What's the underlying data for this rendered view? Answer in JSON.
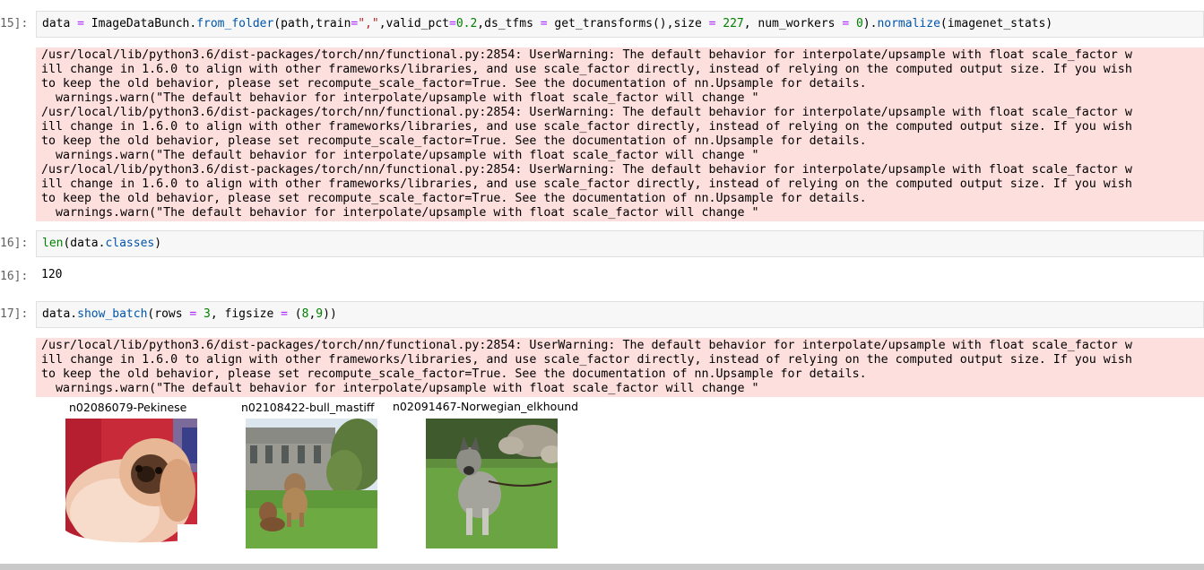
{
  "cells": [
    {
      "prompt": "15]:",
      "code_parts": [
        {
          "t": "data ",
          "c": "plain"
        },
        {
          "t": "=",
          "c": "op"
        },
        {
          "t": " ImageDataBunch.",
          "c": "plain"
        },
        {
          "t": "from_folder",
          "c": "fn"
        },
        {
          "t": "(path,train",
          "c": "plain"
        },
        {
          "t": "=",
          "c": "op"
        },
        {
          "t": "\",\"",
          "c": "str"
        },
        {
          "t": ",valid_pct",
          "c": "plain"
        },
        {
          "t": "=",
          "c": "op"
        },
        {
          "t": "0.2",
          "c": "num"
        },
        {
          "t": ",ds_tfms ",
          "c": "plain"
        },
        {
          "t": "=",
          "c": "op"
        },
        {
          "t": " get_transforms(),size ",
          "c": "plain"
        },
        {
          "t": "=",
          "c": "op"
        },
        {
          "t": " ",
          "c": "plain"
        },
        {
          "t": "227",
          "c": "num"
        },
        {
          "t": ", num_workers ",
          "c": "plain"
        },
        {
          "t": "=",
          "c": "op"
        },
        {
          "t": " ",
          "c": "plain"
        },
        {
          "t": "0",
          "c": "num"
        },
        {
          "t": ").",
          "c": "plain"
        },
        {
          "t": "normalize",
          "c": "fn"
        },
        {
          "t": "(imagenet_stats)",
          "c": "plain"
        }
      ],
      "stderr": [
        "/usr/local/lib/python3.6/dist-packages/torch/nn/functional.py:2854: UserWarning: The default behavior for interpolate/upsample with float scale_factor w",
        "ill change in 1.6.0 to align with other frameworks/libraries, and use scale_factor directly, instead of relying on the computed output size. If you wish",
        "to keep the old behavior, please set recompute_scale_factor=True. See the documentation of nn.Upsample for details.",
        "  warnings.warn(\"The default behavior for interpolate/upsample with float scale_factor will change \"",
        "/usr/local/lib/python3.6/dist-packages/torch/nn/functional.py:2854: UserWarning: The default behavior for interpolate/upsample with float scale_factor w",
        "ill change in 1.6.0 to align with other frameworks/libraries, and use scale_factor directly, instead of relying on the computed output size. If you wish",
        "to keep the old behavior, please set recompute_scale_factor=True. See the documentation of nn.Upsample for details.",
        "  warnings.warn(\"The default behavior for interpolate/upsample with float scale_factor will change \"",
        "/usr/local/lib/python3.6/dist-packages/torch/nn/functional.py:2854: UserWarning: The default behavior for interpolate/upsample with float scale_factor w",
        "ill change in 1.6.0 to align with other frameworks/libraries, and use scale_factor directly, instead of relying on the computed output size. If you wish",
        "to keep the old behavior, please set recompute_scale_factor=True. See the documentation of nn.Upsample for details.",
        "  warnings.warn(\"The default behavior for interpolate/upsample with float scale_factor will change \""
      ]
    },
    {
      "prompt": "16]:",
      "code_parts": [
        {
          "t": "len",
          "c": "num"
        },
        {
          "t": "(data.",
          "c": "plain"
        },
        {
          "t": "classes",
          "c": "fn"
        },
        {
          "t": ")",
          "c": "plain"
        }
      ],
      "out_prompt": "16]:",
      "output": "120"
    },
    {
      "prompt": "17]:",
      "code_parts": [
        {
          "t": "data.",
          "c": "plain"
        },
        {
          "t": "show_batch",
          "c": "fn"
        },
        {
          "t": "(rows ",
          "c": "plain"
        },
        {
          "t": "=",
          "c": "op"
        },
        {
          "t": " ",
          "c": "plain"
        },
        {
          "t": "3",
          "c": "num"
        },
        {
          "t": ", figsize ",
          "c": "plain"
        },
        {
          "t": "=",
          "c": "op"
        },
        {
          "t": " (",
          "c": "plain"
        },
        {
          "t": "8",
          "c": "num"
        },
        {
          "t": ",",
          "c": "plain"
        },
        {
          "t": "9",
          "c": "num"
        },
        {
          "t": "))",
          "c": "plain"
        }
      ],
      "stderr": [
        "/usr/local/lib/python3.6/dist-packages/torch/nn/functional.py:2854: UserWarning: The default behavior for interpolate/upsample with float scale_factor w",
        "ill change in 1.6.0 to align with other frameworks/libraries, and use scale_factor directly, instead of relying on the computed output size. If you wish",
        "to keep the old behavior, please set recompute_scale_factor=True. See the documentation of nn.Upsample for details.",
        "  warnings.warn(\"The default behavior for interpolate/upsample with float scale_factor will change \""
      ]
    }
  ],
  "batch": [
    {
      "label": "n02086079-Pekinese",
      "image": "pekinese-dog-photo"
    },
    {
      "label": "n02108422-bull_mastiff",
      "image": "bull-mastiff-dogs-photo"
    },
    {
      "label": "n02091467-Norwegian_elkhound",
      "image": "norwegian-elkhound-dog-photo"
    }
  ]
}
